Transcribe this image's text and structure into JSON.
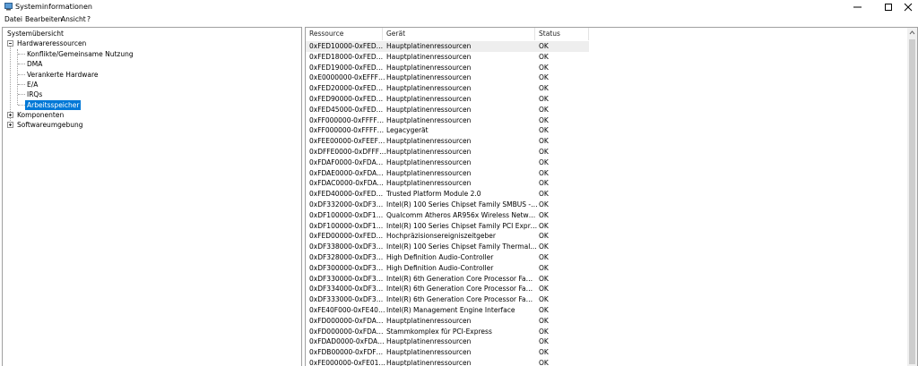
{
  "window": {
    "title": "Systeminformationen"
  },
  "menu": [
    "Datei",
    "Bearbeiten",
    "Ansicht",
    "?"
  ],
  "tree": {
    "root": "Systemübersicht",
    "hardware": "Hardwareressourcen",
    "children": [
      "Konflikte/Gemeinsame Nutzung",
      "DMA",
      "Verankerte Hardware",
      "E/A",
      "IRQs",
      "Arbeitsspeicher"
    ],
    "components": "Komponenten",
    "software": "Softwareumgebung"
  },
  "table": {
    "columns": [
      "Ressource",
      "Gerät",
      "Status"
    ],
    "rows": [
      [
        "0xFED10000-0xFED17FFF",
        "Hauptplatinenressourcen",
        "OK"
      ],
      [
        "0xFED18000-0xFED18FFF",
        "Hauptplatinenressourcen",
        "OK"
      ],
      [
        "0xFED19000-0xFED19FFF",
        "Hauptplatinenressourcen",
        "OK"
      ],
      [
        "0xE0000000-0xEFFFFFFF",
        "Hauptplatinenressourcen",
        "OK"
      ],
      [
        "0xFED20000-0xFED3FFFF",
        "Hauptplatinenressourcen",
        "OK"
      ],
      [
        "0xFED90000-0xFED93FFF",
        "Hauptplatinenressourcen",
        "OK"
      ],
      [
        "0xFED45000-0xFED8FFFF",
        "Hauptplatinenressourcen",
        "OK"
      ],
      [
        "0xFF000000-0xFFFFFFFF",
        "Hauptplatinenressourcen",
        "OK"
      ],
      [
        "0xFF000000-0xFFFFFFFF",
        "Legacygerät",
        "OK"
      ],
      [
        "0xFEE00000-0xFEEFFFFF",
        "Hauptplatinenressourcen",
        "OK"
      ],
      [
        "0xDFFE0000-0xDFFFFFFF",
        "Hauptplatinenressourcen",
        "OK"
      ],
      [
        "0xFDAF0000-0xFDAFFFFF",
        "Hauptplatinenressourcen",
        "OK"
      ],
      [
        "0xFDAE0000-0xFDAEFF...",
        "Hauptplatinenressourcen",
        "OK"
      ],
      [
        "0xFDAC0000-0xFDACFF...",
        "Hauptplatinenressourcen",
        "OK"
      ],
      [
        "0xFED40000-0xFED408...",
        "Trusted Platform Module 2.0",
        "OK"
      ],
      [
        "0xDF332000-0xDF3320...",
        "Intel(R) 100 Series Chipset Family SMBUS - 9D23",
        "OK"
      ],
      [
        "0xDF100000-0xDF17FFFF",
        "Qualcomm Atheros AR956x Wireless Network A...",
        "OK"
      ],
      [
        "0xDF100000-0xDF17FFFF",
        "Intel(R) 100 Series Chipset Family PCI Express R...",
        "OK"
      ],
      [
        "0xFED00000-0xFED003...",
        "Hochpräzisionsereigniszeitgeber",
        "OK"
      ],
      [
        "0xDF338000-0xDF338FFF",
        "Intel(R) 100 Series Chipset Family Thermal subsy...",
        "OK"
      ],
      [
        "0xDF328000-0xDF32BFFF",
        "High Definition Audio-Controller",
        "OK"
      ],
      [
        "0xDF300000-0xDF30FFFF",
        "High Definition Audio-Controller",
        "OK"
      ],
      [
        "0xDF330000-0xDF331FFF",
        "Intel(R) 6th Generation Core Processor Family Pl...",
        "OK"
      ],
      [
        "0xDF334000-0xDF3340...",
        "Intel(R) 6th Generation Core Processor Family Pl...",
        "OK"
      ],
      [
        "0xDF333000-0xDF3337...",
        "Intel(R) 6th Generation Core Processor Family Pl...",
        "OK"
      ],
      [
        "0xFE40F000-0xFE40FFFF",
        "Intel(R) Management Engine Interface",
        "OK"
      ],
      [
        "0xFD000000-0xFDABFFFF",
        "Hauptplatinenressourcen",
        "OK"
      ],
      [
        "0xFD000000-0xFDABFFFF",
        "Stammkomplex für PCI-Express",
        "OK"
      ],
      [
        "0xFDAD0000-0xFDADF...",
        "Hauptplatinenressourcen",
        "OK"
      ],
      [
        "0xFDB00000-0xFDFFFFFF",
        "Hauptplatinenressourcen",
        "OK"
      ],
      [
        "0xFE000000-0xFE01FFFF",
        "Hauptplatinenressourcen",
        "OK"
      ]
    ]
  }
}
